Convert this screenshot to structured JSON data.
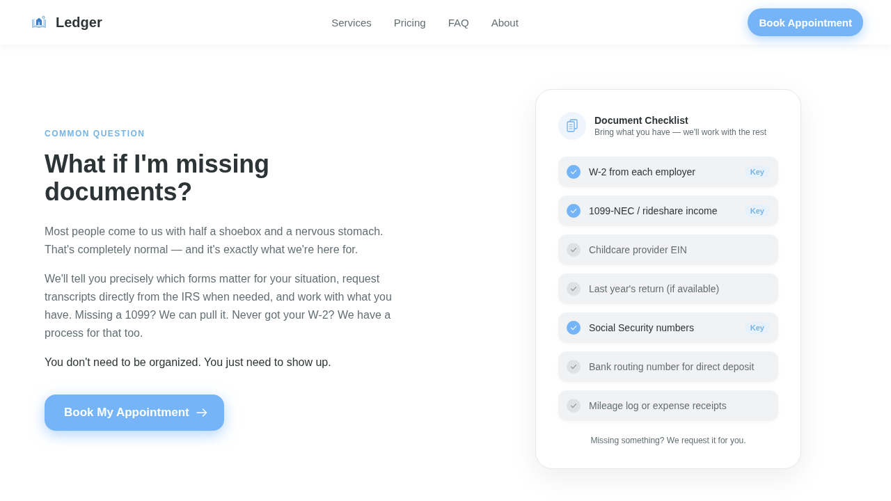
{
  "header": {
    "brand": "Ledger",
    "nav": [
      {
        "label": "Services"
      },
      {
        "label": "Pricing"
      },
      {
        "label": "FAQ"
      },
      {
        "label": "About"
      }
    ],
    "cta": "Book Appointment"
  },
  "intro": {
    "eyebrow": "COMMON QUESTION",
    "title": "What if I'm missing documents?",
    "paragraphs": [
      {
        "kind": "muted",
        "text": "Most people come to us with half a shoebox and a nervous stomach. That's completely normal — and it's exactly what we're here for."
      },
      {
        "kind": "muted",
        "text": "We'll tell you precisely which forms matter for your situation, request transcripts directly from the IRS when needed, and work with what you have. Missing a 1099? We can pull it. Never got your W-2? We have a process for that too."
      },
      {
        "kind": "strong",
        "text": "You don't need to be organized. You just need to show up."
      }
    ],
    "button": "Book My Appointment"
  },
  "checklist": {
    "title": "Document Checklist",
    "subtitle": "Bring what you have — we'll work with the rest",
    "items": [
      {
        "label": "W-2 from each employer",
        "checked": true,
        "badge": "Key"
      },
      {
        "label": "1099-NEC / rideshare income",
        "checked": true,
        "badge": "Key"
      },
      {
        "label": "Childcare provider EIN",
        "checked": false
      },
      {
        "label": "Last year's return (if available)",
        "checked": false
      },
      {
        "label": "Social Security numbers",
        "checked": true,
        "badge": "Key"
      },
      {
        "label": "Bank routing number for direct deposit",
        "checked": false
      },
      {
        "label": "Mileage log or expense receipts",
        "checked": false
      }
    ],
    "footer": "Missing something? We request it for you."
  }
}
